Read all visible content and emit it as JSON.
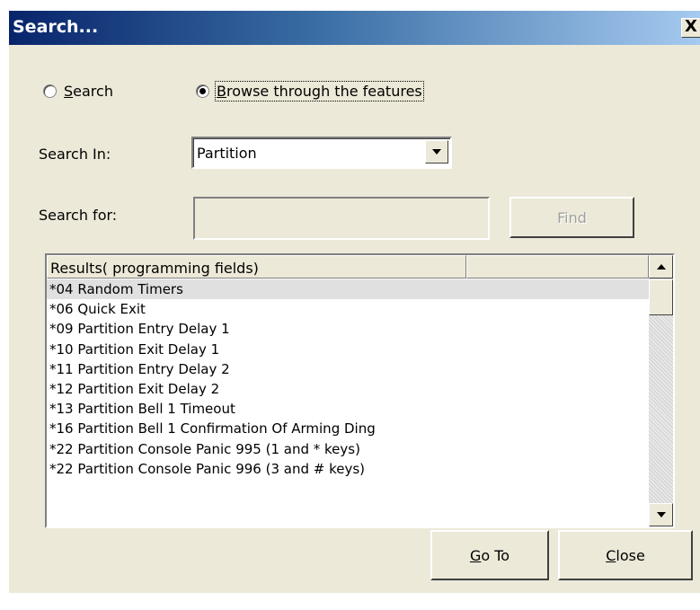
{
  "window": {
    "title": "Search...",
    "close_glyph": "X"
  },
  "mode": {
    "search_label": "Search",
    "search_selected": false,
    "browse_label": "Browse through the features",
    "browse_selected": true
  },
  "search_in": {
    "label": "Search In:",
    "value": "Partition"
  },
  "search_for": {
    "label": "Search for:",
    "value": "",
    "find_label": "Find",
    "find_enabled": false
  },
  "results": {
    "columns": [
      "Results( programming fields)",
      ""
    ],
    "rows": [
      "*04 Random Timers",
      "*06 Quick Exit",
      "*09 Partition Entry Delay 1",
      "*10 Partition Exit Delay 1",
      "*11 Partition Entry Delay 2",
      "*12 Partition Exit Delay 2",
      "*13 Partition Bell 1 Timeout",
      "*16 Partition Bell 1 Confirmation Of Arming Ding",
      "*22 Partition Console Panic 995 (1 and * keys)",
      "*22 Partition Console Panic 996 (3 and # keys)"
    ],
    "selected_index": 0
  },
  "buttons": {
    "goto_label": "Go To",
    "close_label": "Close"
  }
}
